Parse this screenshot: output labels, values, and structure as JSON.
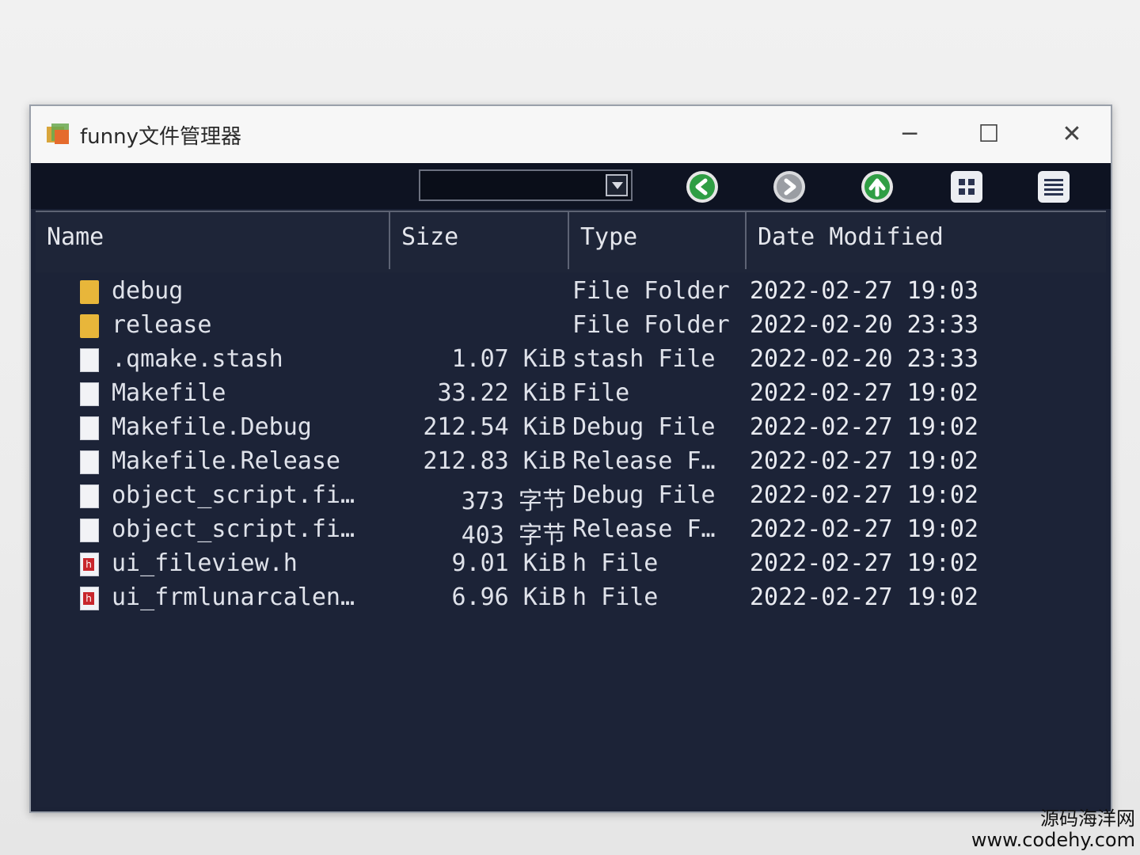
{
  "window": {
    "title": "funny文件管理器"
  },
  "controls": {
    "minimize": "─",
    "maximize": "☐",
    "close": "✕"
  },
  "toolbar": {
    "path_value": "",
    "buttons": [
      {
        "name": "back-icon"
      },
      {
        "name": "forward-icon"
      },
      {
        "name": "up-icon"
      },
      {
        "name": "grid-view-icon"
      },
      {
        "name": "list-view-icon"
      }
    ]
  },
  "table": {
    "columns": [
      "Name",
      "Size",
      "Type",
      "Date Modified"
    ],
    "rows": [
      {
        "icon": "folder-icon",
        "name": "debug",
        "size": "",
        "type": "File Folder",
        "date": "2022-02-27 19:03"
      },
      {
        "icon": "folder-icon",
        "name": "release",
        "size": "",
        "type": "File Folder",
        "date": "2022-02-20 23:33"
      },
      {
        "icon": "file-icon",
        "name": ".qmake.stash",
        "size": "1.07 KiB",
        "type": "stash File",
        "date": "2022-02-20 23:33"
      },
      {
        "icon": "file-icon",
        "name": "Makefile",
        "size": "33.22 KiB",
        "type": "File",
        "date": "2022-02-27 19:02"
      },
      {
        "icon": "file-icon",
        "name": "Makefile.Debug",
        "size": "212.54 KiB",
        "type": "Debug File",
        "date": "2022-02-27 19:02"
      },
      {
        "icon": "file-icon",
        "name": "Makefile.Release",
        "size": "212.83 KiB",
        "type": "Release F…",
        "date": "2022-02-27 19:02"
      },
      {
        "icon": "file-icon",
        "name": "object_script.fi…",
        "size": "373 字节",
        "type": "Debug File",
        "date": "2022-02-27 19:02"
      },
      {
        "icon": "file-icon",
        "name": "object_script.fi…",
        "size": "403 字节",
        "type": "Release F…",
        "date": "2022-02-27 19:02"
      },
      {
        "icon": "h-file-icon",
        "name": "ui_fileview.h",
        "size": "9.01 KiB",
        "type": "h File",
        "date": "2022-02-27 19:02"
      },
      {
        "icon": "h-file-icon",
        "name": "ui_frmlunarcalen…",
        "size": "6.96 KiB",
        "type": "h File",
        "date": "2022-02-27 19:02"
      }
    ]
  },
  "watermark": {
    "cn": "源码海洋网",
    "url": "www.codehy.com"
  }
}
